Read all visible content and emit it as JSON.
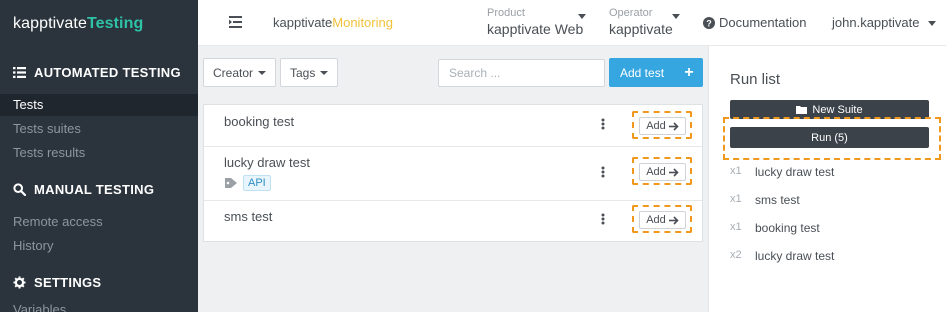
{
  "sidebar": {
    "brand_main": "kapptivate",
    "brand_accent": "Testing",
    "sections": [
      {
        "title": "AUTOMATED TESTING",
        "icon": "list-icon",
        "items": [
          "Tests",
          "Tests suites",
          "Tests results"
        ]
      },
      {
        "title": "MANUAL TESTING",
        "icon": "search-icon",
        "items": [
          "Remote access",
          "History"
        ]
      },
      {
        "title": "SETTINGS",
        "icon": "gear-icon",
        "items": [
          "Variables"
        ]
      }
    ],
    "active_item": "Tests"
  },
  "topbar": {
    "app_main": "kapptivate",
    "app_accent": "Monitoring",
    "product_label": "Product",
    "product_value": "kapptivate Web",
    "operator_label": "Operator",
    "operator_value": "kapptivate",
    "documentation": "Documentation",
    "user": "john.kapptivate"
  },
  "toolbar": {
    "creator_label": "Creator",
    "tags_label": "Tags",
    "search_placeholder": "Search ...",
    "add_test_label": "Add test",
    "add_test_plus": "+"
  },
  "tests": [
    {
      "name": "booking test",
      "add_label": "Add",
      "tags": []
    },
    {
      "name": "lucky draw test",
      "add_label": "Add",
      "tags": [
        "API"
      ]
    },
    {
      "name": "sms test",
      "add_label": "Add",
      "tags": []
    }
  ],
  "run_panel": {
    "title": "Run list",
    "new_suite_label": "New Suite",
    "run_label": "Run (5)",
    "queue": [
      {
        "mult": "x1",
        "name": "lucky draw test"
      },
      {
        "mult": "x1",
        "name": "sms test"
      },
      {
        "mult": "x1",
        "name": "booking test"
      },
      {
        "mult": "x2",
        "name": "lucky draw test"
      }
    ]
  },
  "colors": {
    "sidebar_bg": "#2b333c",
    "brand_accent": "#2ec2a6",
    "monitoring_accent": "#f0c23a",
    "primary_button": "#36a6e0",
    "highlight_dashed": "#f0981e",
    "dark_button": "#3b424a"
  }
}
